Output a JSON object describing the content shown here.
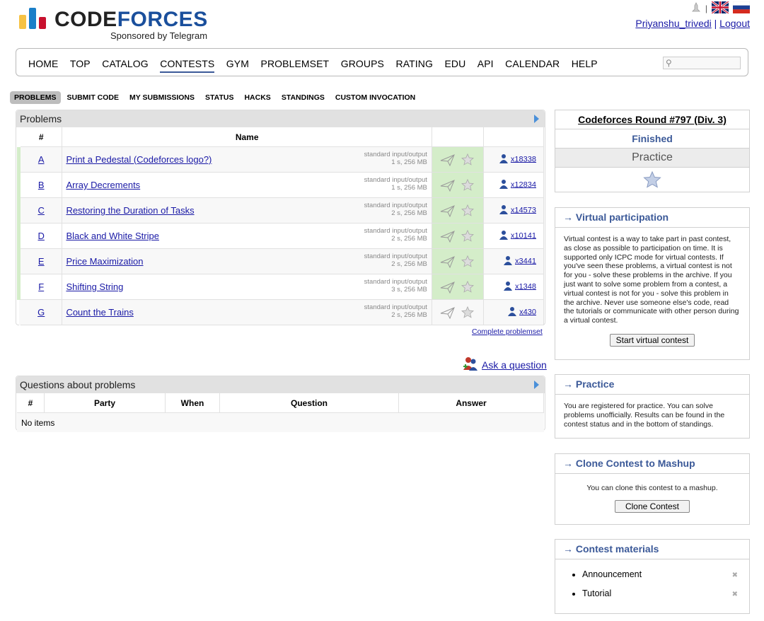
{
  "header": {
    "logo_code": "CODE",
    "logo_forces": "FORCES",
    "sponsor": "Sponsored by Telegram",
    "username": "Priyanshu_trivedi",
    "separator": "|",
    "logout": "Logout",
    "lang_sep": "|"
  },
  "menu": [
    "HOME",
    "TOP",
    "CATALOG",
    "CONTESTS",
    "GYM",
    "PROBLEMSET",
    "GROUPS",
    "RATING",
    "EDU",
    "API",
    "CALENDAR",
    "HELP"
  ],
  "submenu": [
    "PROBLEMS",
    "SUBMIT CODE",
    "MY SUBMISSIONS",
    "STATUS",
    "HACKS",
    "STANDINGS",
    "CUSTOM INVOCATION"
  ],
  "problems": {
    "caption": "Problems",
    "col_index": "#",
    "col_name": "Name",
    "rows": [
      {
        "index": "A",
        "name": "Print a Pedestal (Codeforces logo?)",
        "io": "standard input/output",
        "limits": "1 s, 256 MB",
        "count": "x18338",
        "accepted": true
      },
      {
        "index": "B",
        "name": "Array Decrements",
        "io": "standard input/output",
        "limits": "1 s, 256 MB",
        "count": "x12834",
        "accepted": true
      },
      {
        "index": "C",
        "name": "Restoring the Duration of Tasks",
        "io": "standard input/output",
        "limits": "2 s, 256 MB",
        "count": "x14573",
        "accepted": true
      },
      {
        "index": "D",
        "name": "Black and White Stripe",
        "io": "standard input/output",
        "limits": "2 s, 256 MB",
        "count": "x10141",
        "accepted": true
      },
      {
        "index": "E",
        "name": "Price Maximization",
        "io": "standard input/output",
        "limits": "2 s, 256 MB",
        "count": "x3441",
        "accepted": true
      },
      {
        "index": "F",
        "name": "Shifting String",
        "io": "standard input/output",
        "limits": "3 s, 256 MB",
        "count": "x1348",
        "accepted": true
      },
      {
        "index": "G",
        "name": "Count the Trains",
        "io": "standard input/output",
        "limits": "2 s, 256 MB",
        "count": "x430",
        "accepted": false
      }
    ],
    "complete_link": "Complete problemset"
  },
  "ask_question": "Ask a question",
  "questions": {
    "caption": "Questions about problems",
    "columns": [
      "#",
      "Party",
      "When",
      "Question",
      "Answer"
    ],
    "empty": "No items"
  },
  "round": {
    "title": "Codeforces Round #797 (Div. 3)",
    "status": "Finished",
    "phase": "Practice"
  },
  "virtual": {
    "title": "→ Virtual participation",
    "text": "Virtual contest is a way to take part in past contest, as close as possible to participation on time. It is supported only ICPC mode for virtual contests. If you've seen these problems, a virtual contest is not for you - solve these problems in the archive. If you just want to solve some problem from a contest, a virtual contest is not for you - solve this problem in the archive. Never use someone else's code, read the tutorials or communicate with other person during a virtual contest.",
    "button": "Start virtual contest"
  },
  "practice": {
    "title": "→ Practice",
    "text": "You are registered for practice. You can solve problems unofficially. Results can be found in the contest status and in the bottom of standings."
  },
  "clone": {
    "title": "→ Clone Contest to Mashup",
    "text": "You can clone this contest to a mashup.",
    "button": "Clone Contest"
  },
  "materials": {
    "title": "→ Contest materials",
    "items": [
      "Announcement",
      "Tutorial"
    ],
    "remove_glyph": "✖"
  },
  "colors": {
    "accent": "#3b5998",
    "solved": "#d4edc9",
    "link": "#1a1aa6"
  }
}
